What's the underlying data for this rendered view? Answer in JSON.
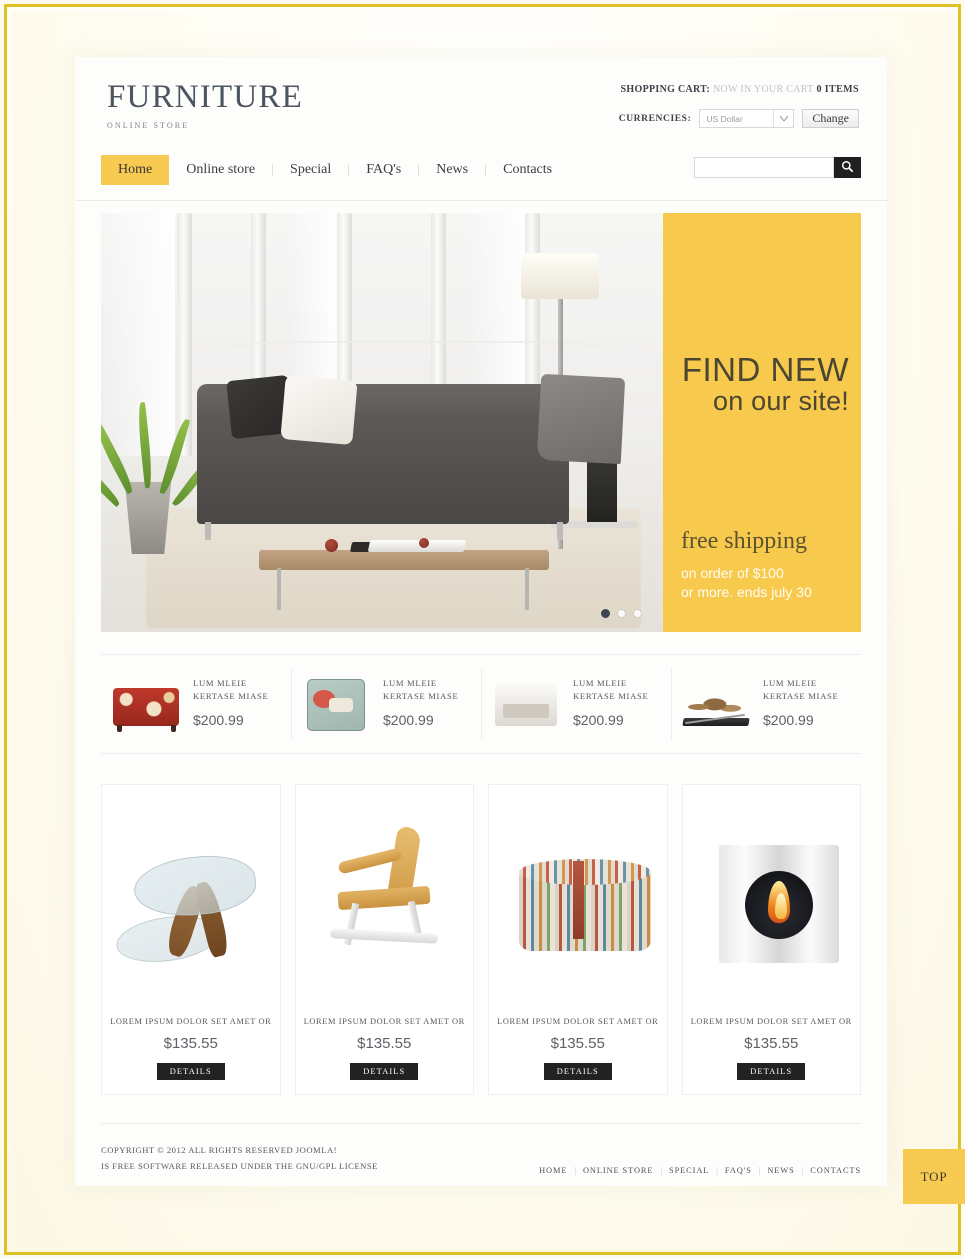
{
  "site": {
    "logo_title": "FURNITURE",
    "logo_subtitle": "ONLINE STORE"
  },
  "header": {
    "cart_label": "SHOPPING CART:",
    "cart_text": "NOW IN YOUR CART",
    "cart_count": "0 ITEMS",
    "currencies_label": "CURRENCIES:",
    "currency_value": "US Dollar",
    "currency_chevron": "⌄",
    "change_button": "Change"
  },
  "nav": {
    "items": [
      {
        "label": "Home",
        "active": true
      },
      {
        "label": "Online store",
        "active": false
      },
      {
        "label": "Special",
        "active": false
      },
      {
        "label": "FAQ's",
        "active": false
      },
      {
        "label": "News",
        "active": false
      },
      {
        "label": "Contacts",
        "active": false
      }
    ]
  },
  "search": {
    "value": "",
    "placeholder": "",
    "icon": "search-icon"
  },
  "hero": {
    "headline_top": "FIND NEW",
    "headline_bottom": "on our site!",
    "offer_title": "free shipping",
    "offer_line1": "on order of $100",
    "offer_line2": "or more. ends july 30",
    "panel_color": "#f7c94d",
    "dots": [
      {
        "active": true
      },
      {
        "active": false
      },
      {
        "active": false
      }
    ]
  },
  "featured_strip": [
    {
      "name": "LUM MLEIE KERTASE MIASE",
      "price": "$200.99",
      "thumb": "red-ottoman"
    },
    {
      "name": "LUM MLEIE KERTASE MIASE",
      "price": "$200.99",
      "thumb": "deer-pillow"
    },
    {
      "name": "LUM MLEIE KERTASE MIASE",
      "price": "$200.99",
      "thumb": "white-armchair"
    },
    {
      "name": "LUM MLEIE KERTASE MIASE",
      "price": "$200.99",
      "thumb": "log-holder"
    }
  ],
  "products": [
    {
      "name": "LOREM IPSUM DOLOR SET AMET OR",
      "price": "$135.55",
      "button": "DETAILS",
      "art": "glass-coffee-table"
    },
    {
      "name": "LOREM IPSUM DOLOR SET AMET OR",
      "price": "$135.55",
      "button": "DETAILS",
      "art": "wood-rocking-chair"
    },
    {
      "name": "LOREM IPSUM DOLOR SET AMET OR",
      "price": "$135.55",
      "button": "DETAILS",
      "art": "striped-pouf"
    },
    {
      "name": "LOREM IPSUM DOLOR SET AMET OR",
      "price": "$135.55",
      "button": "DETAILS",
      "art": "modern-fireplace"
    }
  ],
  "footer": {
    "copyright_line1": "COPYRIGHT © 2012 ALL RIGHTS RESERVED JOOMLA!",
    "copyright_line2": "IS FREE SOFTWARE RELEASED UNDER THE GNU/GPL LICENSE",
    "nav": [
      "HOME",
      "ONLINE STORE",
      "SPECIAL",
      "FAQ's",
      "NEWS",
      "CONTACTS"
    ],
    "separator": "|",
    "top_button": "TOP"
  },
  "theme": {
    "accent": "#f7ca52",
    "frame_border": "#dfc025",
    "page_bg": "#fdfbef",
    "dark": "#222222"
  }
}
